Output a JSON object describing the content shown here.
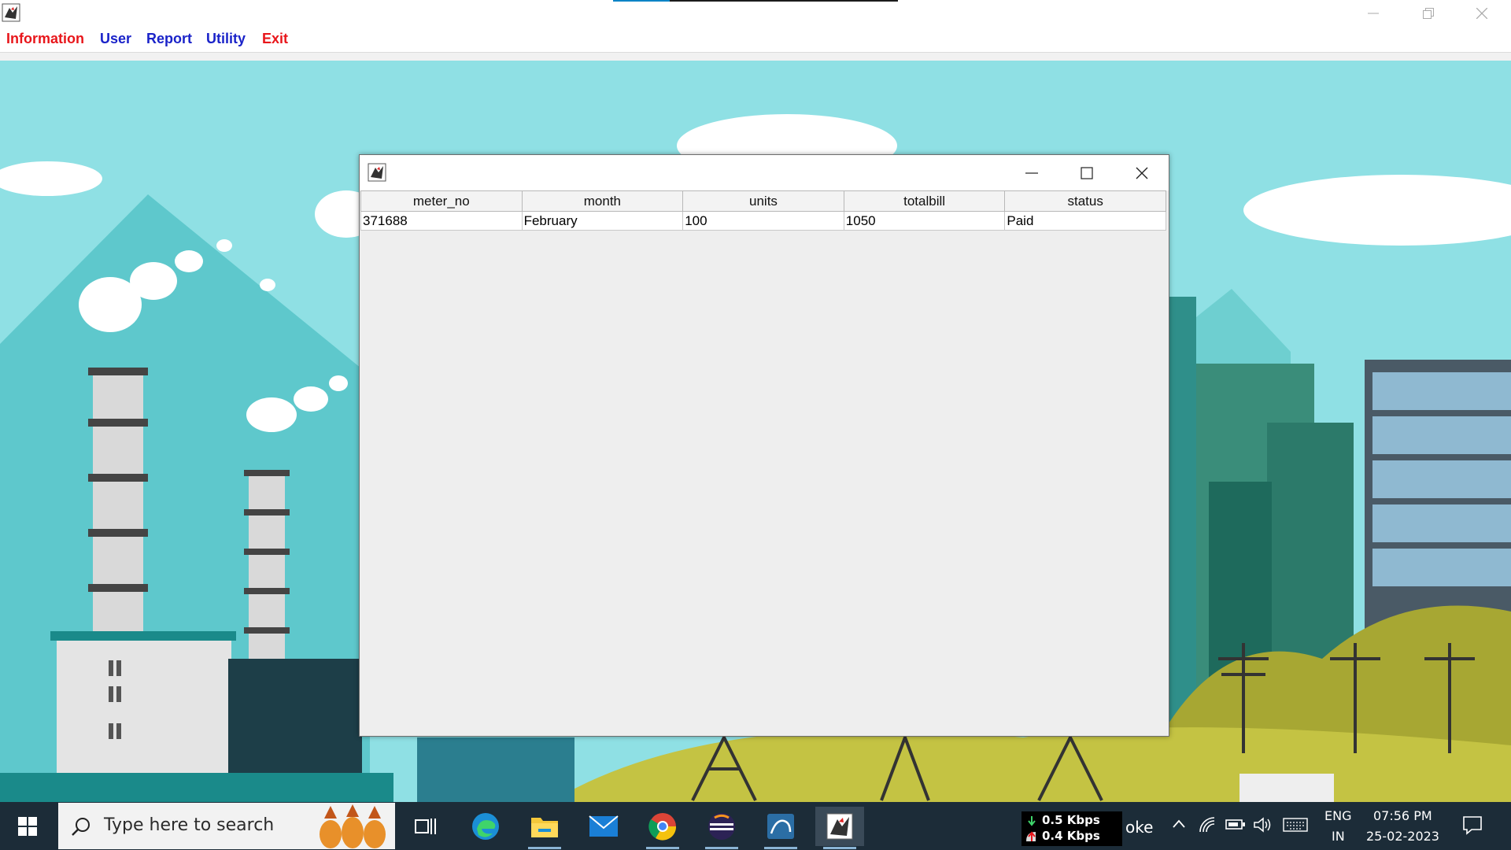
{
  "main_window": {
    "menu": [
      {
        "label": "Information",
        "color": "#e8161b"
      },
      {
        "label": "User",
        "color": "#1a23c9"
      },
      {
        "label": "Report",
        "color": "#1a23c9"
      },
      {
        "label": "Utility",
        "color": "#1a23c9"
      },
      {
        "label": "Exit",
        "color": "#e8161b"
      }
    ],
    "controls": [
      "minimize-icon",
      "restore-icon",
      "close-icon"
    ]
  },
  "bill_window": {
    "controls": [
      "minimize-icon",
      "maximize-icon",
      "close-icon"
    ],
    "columns": [
      "meter_no",
      "month",
      "units",
      "totalbill",
      "status"
    ],
    "rows": [
      [
        "371688",
        "February",
        "100",
        "1050",
        "Paid"
      ]
    ]
  },
  "taskbar": {
    "search_placeholder": "Type here to search",
    "apps": [
      "task-view-icon",
      "edge-icon",
      "file-explorer-icon",
      "mail-icon",
      "chrome-icon",
      "eclipse-icon",
      "mysql-workbench-icon",
      "java-app-icon"
    ],
    "network": {
      "download": "0.5 Kbps",
      "upload": "0.4 Kbps"
    },
    "ticker": "oke",
    "language": {
      "line1": "ENG",
      "line2": "IN"
    },
    "clock": {
      "time": "07:56 PM",
      "date": "25-02-2023"
    }
  },
  "colors": {
    "menu_red": "#e8161b",
    "menu_blue": "#1a23c9",
    "sky": "#8fe0e4",
    "taskbar": "#1c2c38"
  }
}
